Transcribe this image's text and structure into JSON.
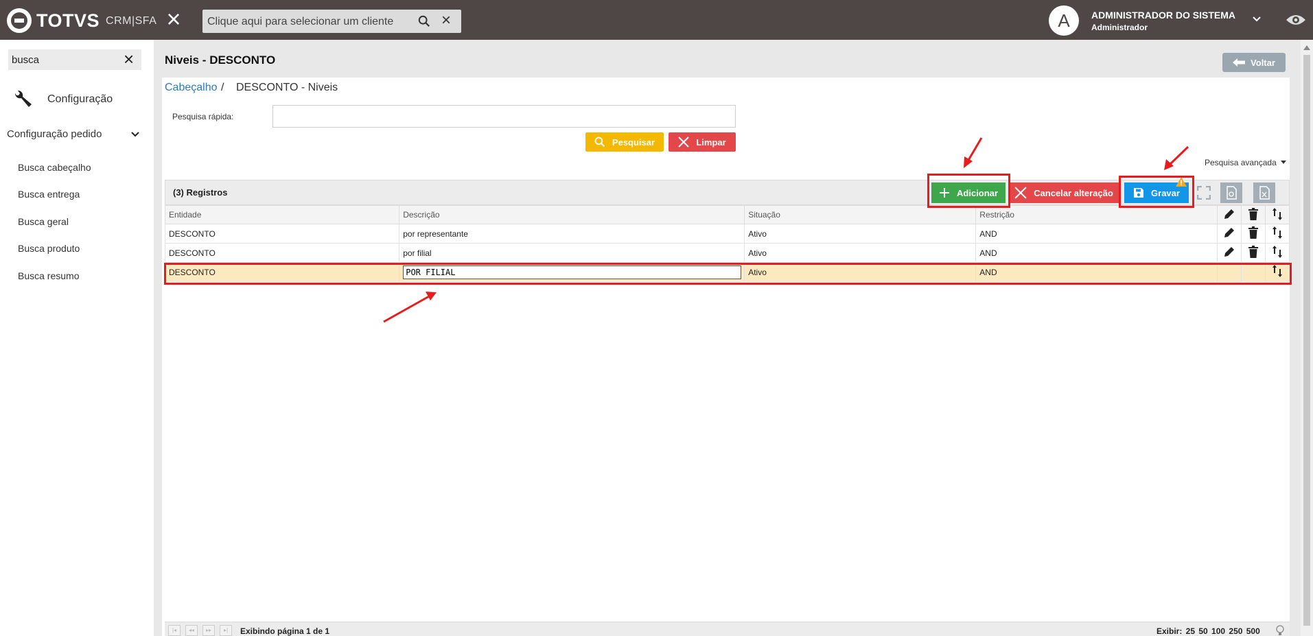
{
  "topbar": {
    "logo_text": "TOTVS",
    "logo_sub": "CRM|SFA",
    "client_search_placeholder": "Clique aqui para selecionar um cliente",
    "avatar_letter": "A",
    "user_name": "ADMINISTRADOR DO SISTEMA",
    "user_role": "Administrador"
  },
  "sidebar": {
    "search_value": "busca",
    "config_label": "Configuração",
    "group_label": "Configuração pedido",
    "items": [
      {
        "label": "Busca cabeçalho"
      },
      {
        "label": "Busca entrega"
      },
      {
        "label": "Busca geral"
      },
      {
        "label": "Busca produto"
      },
      {
        "label": "Busca resumo"
      }
    ]
  },
  "page": {
    "title": "Niveis - DESCONTO",
    "back_label": "Voltar",
    "breadcrumb": {
      "link": "Cabeçalho",
      "separator": "/",
      "current": "DESCONTO - Niveis"
    }
  },
  "filter": {
    "quick_search_label": "Pesquisa rápida:",
    "quick_search_value": "",
    "search_label": "Pesquisar",
    "clear_label": "Limpar",
    "advanced_label": "Pesquisa avançada"
  },
  "grid": {
    "records_label": "(3) Registros",
    "add_label": "Adicionar",
    "cancel_label": "Cancelar alteração",
    "save_label": "Gravar",
    "columns": [
      "Entidade",
      "Descrição",
      "Situação",
      "Restrição"
    ],
    "rows": [
      {
        "entidade": "DESCONTO",
        "descricao": "por representante",
        "situacao": "Ativo",
        "restricao": "AND"
      },
      {
        "entidade": "DESCONTO",
        "descricao": "por filial",
        "situacao": "Ativo",
        "restricao": "AND"
      },
      {
        "entidade": "DESCONTO",
        "descricao": "POR FILIAL",
        "situacao": "Ativo",
        "restricao": "AND"
      }
    ]
  },
  "pager": {
    "info": "Exibindo página 1 de 1",
    "exibir": "Exibir:  25  50  100  250  500"
  },
  "colors": {
    "topbar": "#4e4746",
    "accent_link": "#2a7bbf",
    "add": "#3ea64b",
    "cancel": "#e4474a",
    "save": "#1296e8",
    "search": "#f5b800",
    "selected_row": "#fde9c0",
    "annotation": "#e81c1c"
  }
}
